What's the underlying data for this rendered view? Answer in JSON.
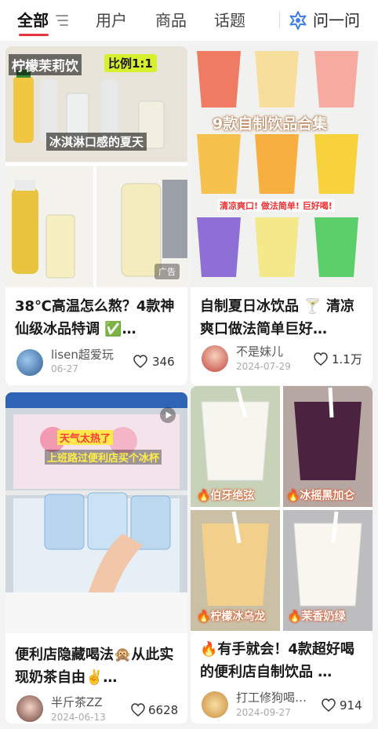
{
  "tabs": [
    {
      "label": "全部",
      "active": true
    },
    {
      "label": "用户",
      "active": false
    },
    {
      "label": "商品",
      "active": false
    },
    {
      "label": "话题",
      "active": false
    }
  ],
  "ask": {
    "label": "问一问",
    "icon": "sparkle-icon"
  },
  "accent": "#e8343f",
  "cards": [
    {
      "overlay": {
        "top_left": "柠檬茉莉饮",
        "top_right": "比例1:1",
        "middle": "冰淇淋口感的夏天",
        "badge": "广告"
      },
      "title": "38℃高温怎么熬？4款神仙级冰品特调 ✅…",
      "author": "lisen超爱玩",
      "date": "06-27",
      "likes": "346"
    },
    {
      "overlay": {
        "headline": "9款自制饮品合集",
        "tagline": "清凉爽口! 做法简单! 巨好喝!"
      },
      "title": "自制夏日冰饮品 🍸 清凉爽口做法简单巨好…",
      "author": "不是妹儿",
      "date": "2024-07-29",
      "likes": "1.1万"
    },
    {
      "overlay": {
        "line1": "天气太热了",
        "line2": "上班路过便利店买个冰杯"
      },
      "title": "便利店隐藏喝法🙊从此实现奶茶自由✌️…",
      "author": "半斤茶ZZ",
      "date": "2024-06-13",
      "likes": "6628"
    },
    {
      "overlay": {
        "q1": "🔥伯牙绝弦",
        "q2": "🔥冰摇黑加仑",
        "q3": "🔥柠檬冰乌龙",
        "q4": "🔥茉香奶绿"
      },
      "title": "🔥有手就会！4款超好喝的便利店自制饮品 …",
      "author": "打工修狗喝…",
      "date": "2024-09-27",
      "likes": "914"
    }
  ]
}
